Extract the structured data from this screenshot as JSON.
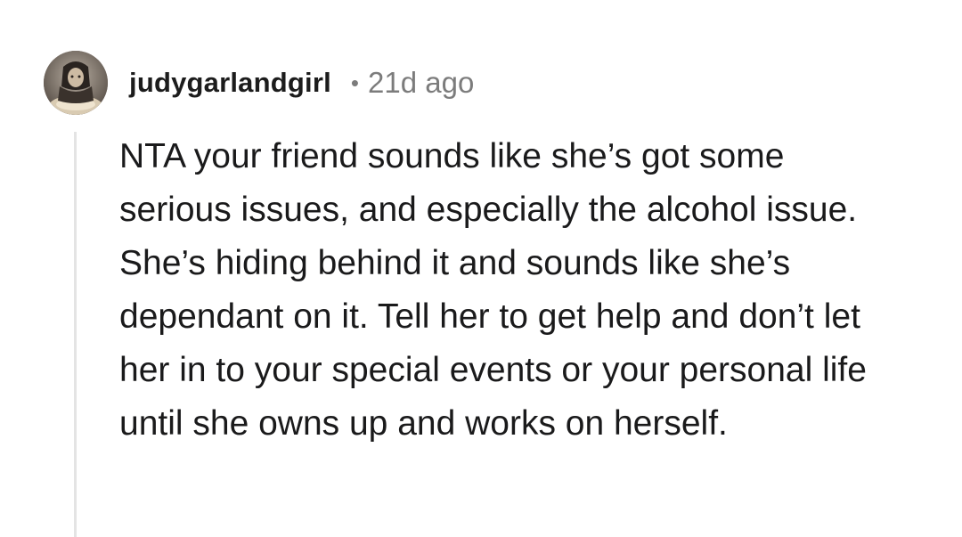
{
  "comment": {
    "author": "judygarlandgirl",
    "separator": "•",
    "timestamp": "21d ago",
    "avatar_icon": "user-avatar-icon",
    "body": "NTA your friend sounds like she’s got some serious issues, and especially the alcohol issue. She’s hiding behind it and sounds like she’s dependant on it. Tell her to get help and don’t let her in to your special events or your personal life until she owns up and works on herself."
  },
  "colors": {
    "background": "#ffffff",
    "text": "#1a1a1b",
    "meta": "#7c7c7c",
    "thread_line": "#e4e4e4"
  }
}
